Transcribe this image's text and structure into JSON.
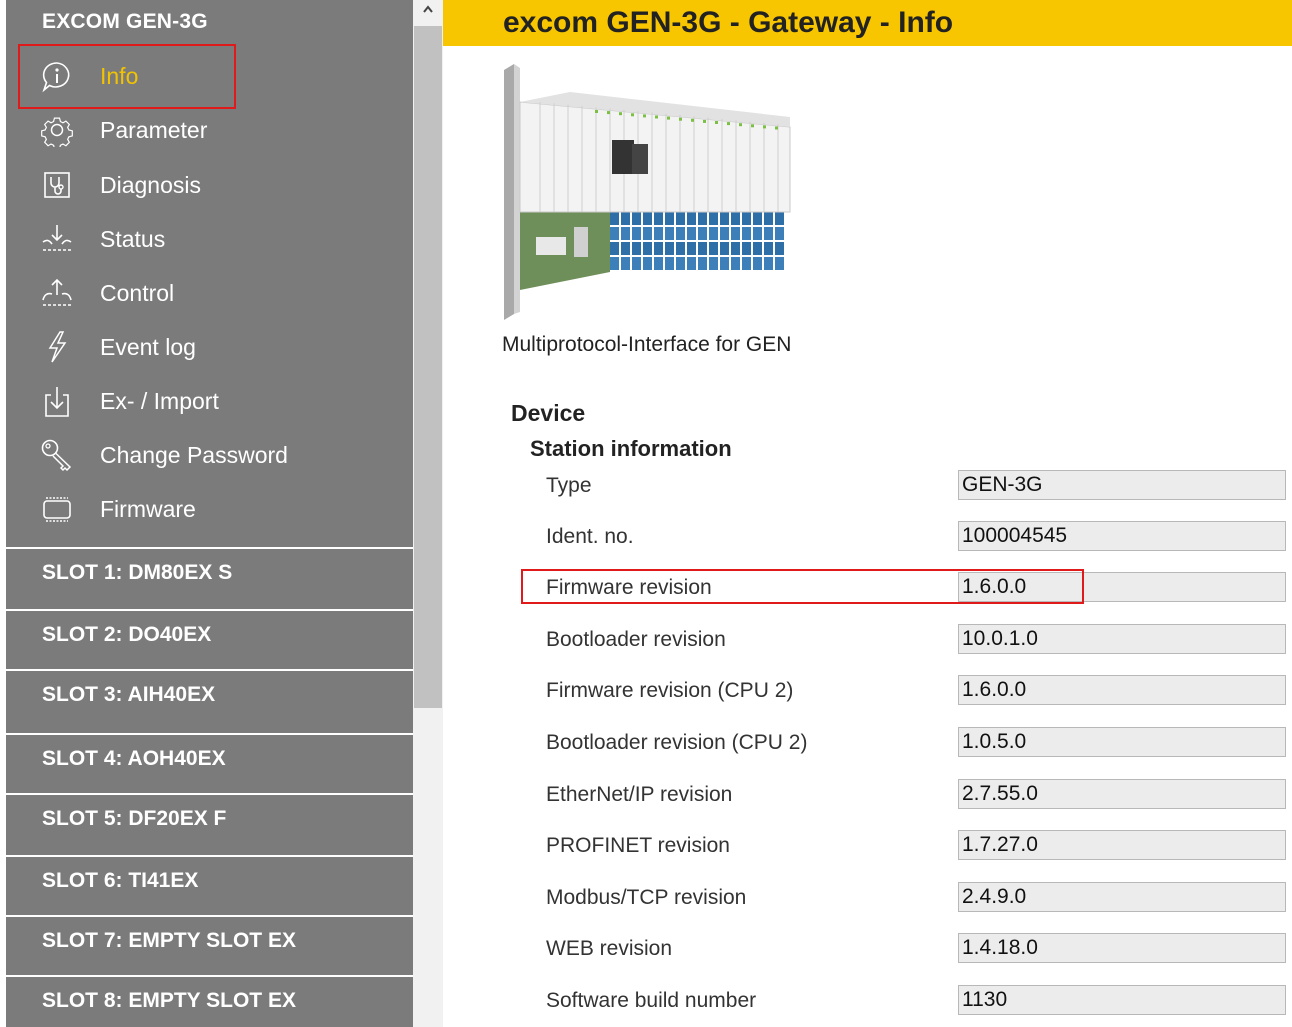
{
  "sidebar": {
    "title": "EXCOM GEN-3G",
    "menu": [
      {
        "id": "info",
        "label": "Info",
        "icon": "info-icon",
        "active": true
      },
      {
        "id": "parameter",
        "label": "Parameter",
        "icon": "gear-icon",
        "active": false
      },
      {
        "id": "diagnosis",
        "label": "Diagnosis",
        "icon": "stethoscope-icon",
        "active": false
      },
      {
        "id": "status",
        "label": "Status",
        "icon": "status-arrows-icon",
        "active": false
      },
      {
        "id": "control",
        "label": "Control",
        "icon": "control-arrows-icon",
        "active": false
      },
      {
        "id": "event-log",
        "label": "Event log",
        "icon": "lightning-icon",
        "active": false
      },
      {
        "id": "ex-import",
        "label": "Ex- / Import",
        "icon": "download-icon",
        "active": false
      },
      {
        "id": "change-password",
        "label": "Change Password",
        "icon": "key-icon",
        "active": false
      },
      {
        "id": "firmware",
        "label": "Firmware",
        "icon": "chip-icon",
        "active": false
      }
    ],
    "slots": [
      "SLOT 1: DM80EX S",
      "SLOT 2: DO40EX",
      "SLOT 3: AIH40EX",
      "SLOT 4: AOH40EX",
      "SLOT 5: DF20EX F",
      "SLOT 6: TI41EX",
      "SLOT 7: EMPTY SLOT EX",
      "SLOT 8: EMPTY SLOT EX"
    ]
  },
  "header": {
    "title": "excom GEN-3G - Gateway - Info"
  },
  "device": {
    "caption": "Multiprotocol-Interface for GEN"
  },
  "section": {
    "title": "Device",
    "subtitle": "Station information"
  },
  "rows": [
    {
      "label": "Type",
      "value": "GEN-3G"
    },
    {
      "label": "Ident. no.",
      "value": "100004545"
    },
    {
      "label": "Firmware revision",
      "value": "1.6.0.0"
    },
    {
      "label": "Bootloader revision",
      "value": "10.0.1.0"
    },
    {
      "label": "Firmware revision (CPU 2)",
      "value": "1.6.0.0"
    },
    {
      "label": "Bootloader revision (CPU 2)",
      "value": "1.0.5.0"
    },
    {
      "label": "EtherNet/IP revision",
      "value": "2.7.55.0"
    },
    {
      "label": "PROFINET revision",
      "value": "1.7.27.0"
    },
    {
      "label": "Modbus/TCP revision",
      "value": "2.4.9.0"
    },
    {
      "label": "WEB revision",
      "value": "1.4.18.0"
    },
    {
      "label": "Software build number",
      "value": "1130"
    }
  ],
  "colors": {
    "sidebar_bg": "#7b7b7b",
    "header_bg": "#f7c600",
    "active_item": "#f2c300",
    "highlight_border": "#e01a1a"
  }
}
